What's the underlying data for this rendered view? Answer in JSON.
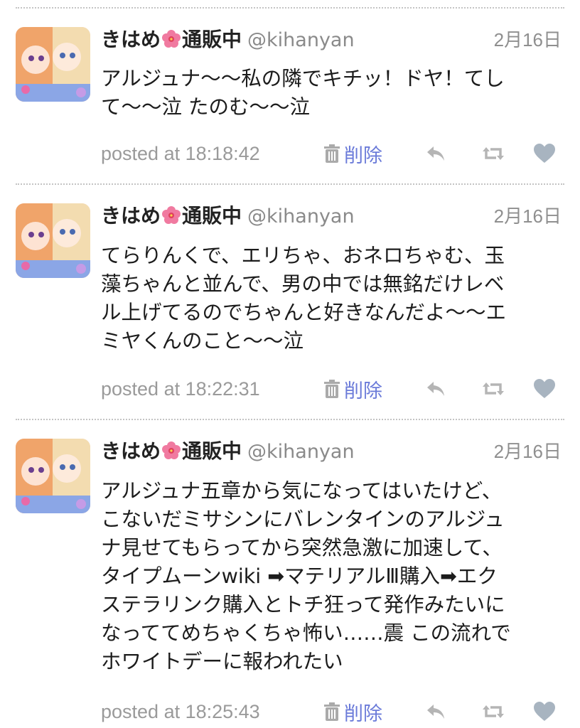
{
  "tweets": [
    {
      "user": {
        "name_prefix": "きはめ",
        "name_suffix": "通販中",
        "name_emoji": "hibiscus-icon",
        "handle": "@kihanyan"
      },
      "date": "2月16日",
      "text": "アルジュナ〜〜私の隣でキチッ！ドヤ！てし\nて〜〜泣 たのむ〜〜泣",
      "posted_at": "posted at 18:18:42",
      "delete_label": "削除"
    },
    {
      "user": {
        "name_prefix": "きはめ",
        "name_suffix": "通販中",
        "name_emoji": "hibiscus-icon",
        "handle": "@kihanyan"
      },
      "date": "2月16日",
      "text": "てらりんくで、エリちゃ、おネロちゃむ、玉\n藻ちゃんと並んで、男の中では無銘だけレベ\nル上げてるのでちゃんと好きなんだよ〜〜エ\nミヤくんのこと〜〜泣",
      "posted_at": "posted at 18:22:31",
      "delete_label": "削除"
    },
    {
      "user": {
        "name_prefix": "きはめ",
        "name_suffix": "通販中",
        "name_emoji": "hibiscus-icon",
        "handle": "@kihanyan"
      },
      "date": "2月16日",
      "text": "アルジュナ五章から気になってはいたけど、\nこないだミサシンにバレンタインのアルジュ\nナ見せてもらってから突然急激に加速して、\nタイプムーンwiki ➡マテリアルⅢ購入➡エク\nステラリンク購入とトチ狂って発作みたいに\nなっててめちゃくちゃ怖い……震 この流れで\nホワイトデーに報われたい",
      "posted_at": "posted at 18:25:43",
      "delete_label": "削除"
    }
  ],
  "colors": {
    "delete_link": "#6b7bd9",
    "meta_gray": "#9a9a9a",
    "divider": "#c4c4c4"
  },
  "icons": [
    "trash-icon",
    "reply-icon",
    "retweet-icon",
    "heart-icon",
    "hibiscus-icon"
  ]
}
